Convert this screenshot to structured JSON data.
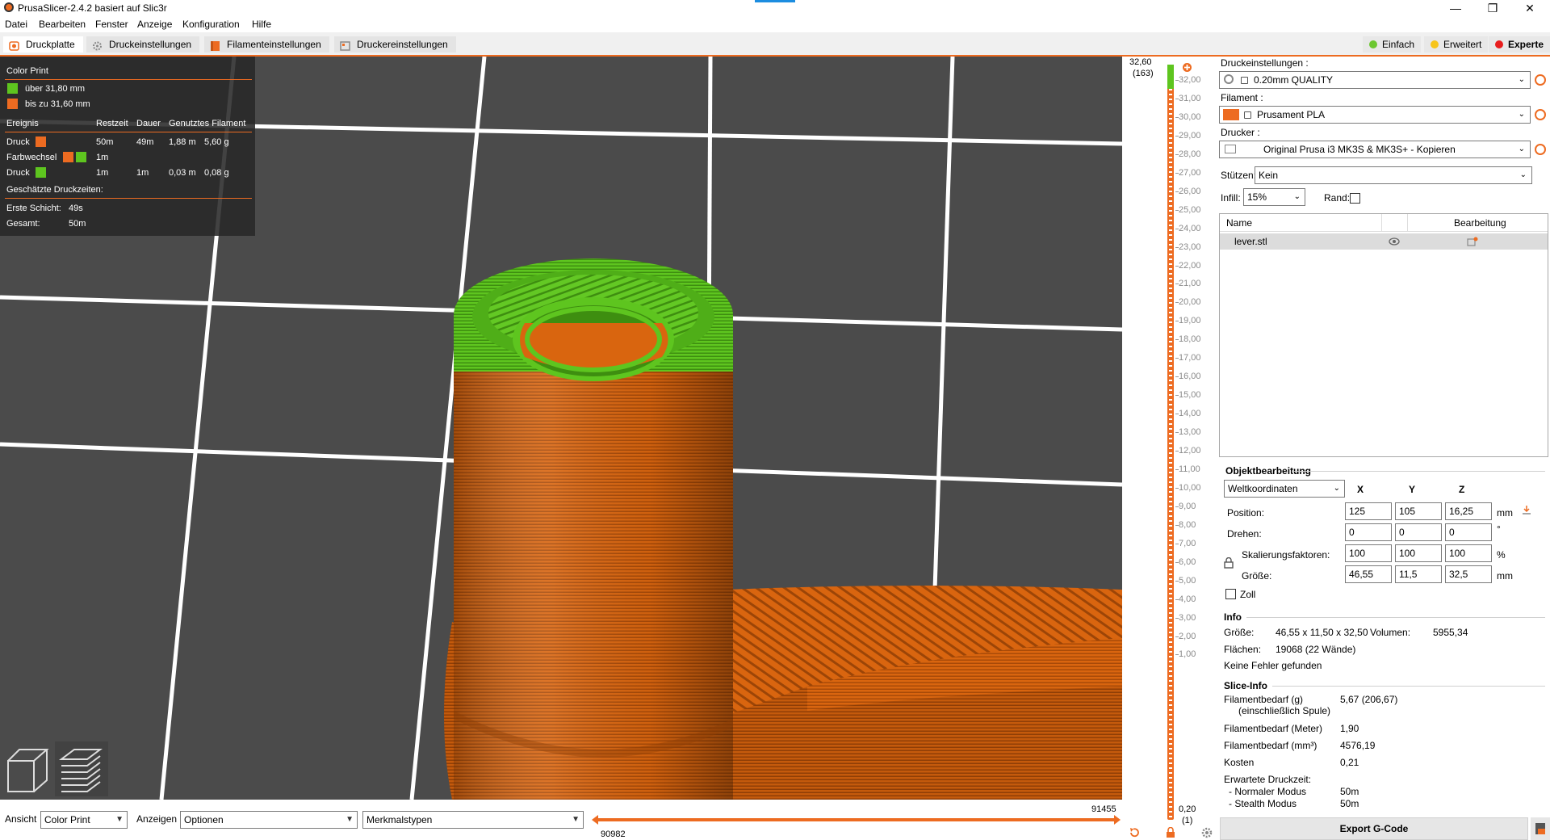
{
  "window": {
    "title": "PrusaSlicer-2.4.2 basiert auf Slic3r",
    "minimize": "—",
    "maximize": "❐",
    "close": "✕"
  },
  "menu": [
    "Datei",
    "Bearbeiten",
    "Fenster",
    "Anzeige",
    "Konfiguration",
    "Hilfe"
  ],
  "tabs": [
    "Druckplatte",
    "Druckeinstellungen",
    "Filamenteinstellungen",
    "Druckereinstellungen"
  ],
  "modes": {
    "items": [
      "Einfach",
      "Erweitert",
      "Experte"
    ],
    "colors": [
      "#6cc730",
      "#f7c51a",
      "#e81e1e"
    ]
  },
  "legend": {
    "title": "Color Print",
    "items": [
      {
        "label": "über 31,80 mm",
        "color": "#5ec51f"
      },
      {
        "label": "bis zu 31,60 mm",
        "color": "#ed6b21"
      }
    ],
    "headers": [
      "Ereignis",
      "Restzeit",
      "Dauer",
      "Genutztes Filament"
    ],
    "rows": [
      {
        "event": "Druck",
        "rest": "50m",
        "dauer": "49m",
        "meter": "1,88 m",
        "gram": "5,60 g"
      },
      {
        "event": "Farbwechsel",
        "rest": "1m",
        "dauer": "",
        "meter": "",
        "gram": ""
      },
      {
        "event": "Druck",
        "rest": "1m",
        "dauer": "1m",
        "meter": "0,03 m",
        "gram": "0,08 g"
      }
    ],
    "times_title": "Geschätzte Druckzeiten:",
    "first_layer_label": "Erste Schicht:",
    "first_layer_value": "49s",
    "total_label": "Gesamt:",
    "total_value": "50m"
  },
  "bottom": {
    "view_label": "Ansicht",
    "view_value": "Color Print",
    "show_label": "Anzeigen",
    "show_value": "Optionen",
    "feature_value": "Merkmalstypen",
    "slider_max": "91455",
    "slider_min": "90982"
  },
  "layer_slider": {
    "top_value": "32,60",
    "top_layer": "(163)",
    "bottom_value": "0,20",
    "bottom_layer": "(1)",
    "ticks": [
      "32,00",
      "31,00",
      "30,00",
      "29,00",
      "28,00",
      "27,00",
      "26,00",
      "25,00",
      "24,00",
      "23,00",
      "22,00",
      "21,00",
      "20,00",
      "19,00",
      "18,00",
      "17,00",
      "16,00",
      "15,00",
      "14,00",
      "13,00",
      "12,00",
      "11,00",
      "10,00",
      "9,00",
      "8,00",
      "7,00",
      "6,00",
      "5,00",
      "4,00",
      "3,00",
      "2,00",
      "1,00"
    ]
  },
  "sidebar": {
    "print_label": "Druckeinstellungen :",
    "print_value": "0.20mm QUALITY",
    "filament_label": "Filament :",
    "filament_value": "Prusament PLA",
    "filament_color": "#ed6b21",
    "printer_label": "Drucker :",
    "printer_value": "Original Prusa i3 MK3S & MK3S+ - Kopieren",
    "supports_label": "Stützen:",
    "supports_value": "Kein",
    "infill_label": "Infill:",
    "infill_value": "15%",
    "brim_label": "Rand:",
    "list_headers": [
      "Name",
      "Bearbeitung"
    ],
    "object_name": "lever.stl",
    "obj_edit_title": "Objektbearbeitung",
    "coord_value": "Weltkoordinaten",
    "axes": [
      "X",
      "Y",
      "Z"
    ],
    "position_label": "Position:",
    "position": [
      "125",
      "105",
      "16,25"
    ],
    "position_unit": "mm",
    "rotate_label": "Drehen:",
    "rotate": [
      "0",
      "0",
      "0"
    ],
    "rotate_unit": "°",
    "scale_label": "Skalierungsfaktoren:",
    "scale": [
      "100",
      "100",
      "100"
    ],
    "scale_unit": "%",
    "size_label": "Größe:",
    "size": [
      "46,55",
      "11,5",
      "32,5"
    ],
    "size_unit": "mm",
    "inch_label": "Zoll",
    "info_title": "Info",
    "info_size_label": "Größe:",
    "info_size_value": "46,55 x 11,50 x 32,50",
    "info_volume_label": "Volumen:",
    "info_volume_value": "5955,34",
    "info_faces_label": "Flächen:",
    "info_faces_value": "19068 (22 Wände)",
    "info_errors": "Keine Fehler gefunden",
    "slice_title": "Slice-Info",
    "fil_g_label": "Filamentbedarf (g)",
    "fil_g_sub": "(einschließlich Spule)",
    "fil_g_value": "5,67 (206,67)",
    "fil_m_label": "Filamentbedarf (Meter)",
    "fil_m_value": "1,90",
    "fil_mm3_label": "Filamentbedarf (mm³)",
    "fil_mm3_value": "4576,19",
    "cost_label": "Kosten",
    "cost_value": "0,21",
    "expected_label": "Erwartete Druckzeit:",
    "normal_label": "- Normaler Modus",
    "normal_value": "50m",
    "stealth_label": "- Stealth Modus",
    "stealth_value": "50m",
    "export_label": "Export G-Code"
  }
}
